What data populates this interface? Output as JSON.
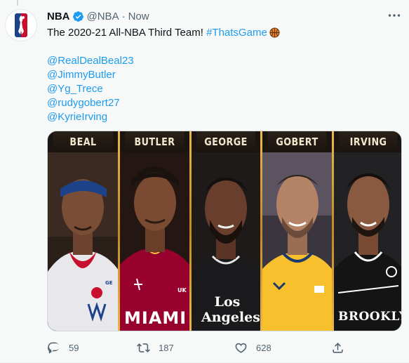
{
  "tweet": {
    "author_name": "NBA",
    "handle": "@NBA",
    "separator": "·",
    "time": "Now",
    "text": {
      "intro": "The 2020-21 All-NBA Third Team! ",
      "hashtag": "#ThatsGame",
      "mentions": [
        "@RealDealBeal23",
        "@JimmyButler",
        "@Yg_Trece",
        "@rudygobert27",
        "@KyrieIrving"
      ]
    },
    "media": {
      "players": [
        "BEAL",
        "BUTLER",
        "GEORGE",
        "GOBERT",
        "IRVING"
      ],
      "jersey_texts": [
        "MIAMI",
        "Los Angeles",
        "BROOKLYN",
        "UK",
        "GE"
      ]
    },
    "actions": {
      "reply_count": "59",
      "retweet_count": "187",
      "like_count": "628"
    }
  },
  "colors": {
    "link": "#1d9bf0",
    "verified": "#1d9bf0",
    "muted": "#536471",
    "gold": "#e9b84d"
  }
}
